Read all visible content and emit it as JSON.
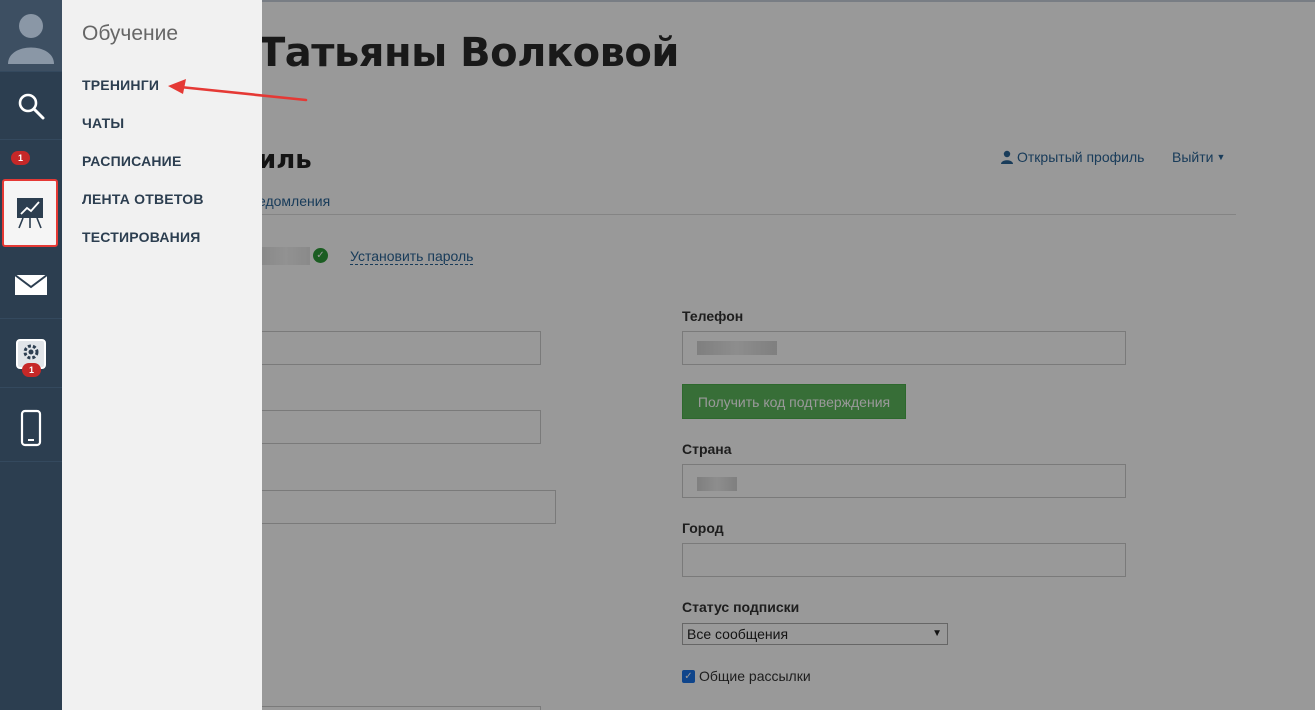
{
  "page": {
    "title": "Татьяны Волковой",
    "section_title": "иль",
    "open_profile": "Открытый профиль",
    "logout": "Выйти",
    "tab_notifications": "едомления",
    "set_password": "Установить пароль"
  },
  "form": {
    "phone_label": "Телефон",
    "get_code_button": "Получить код подтверждения",
    "country_label": "Страна",
    "city_label": "Город",
    "subscription_label": "Статус подписки",
    "subscription_value": "Все сообщения",
    "newsletter_label": "Общие рассылки",
    "newsletter_checked": true
  },
  "sidebar": {
    "badges": {
      "notifications": "1",
      "settings": "1"
    },
    "icons": [
      "user-avatar-icon",
      "search-icon",
      "training-chart-icon",
      "mail-icon",
      "settings-gear-icon",
      "mobile-phone-icon"
    ]
  },
  "menu": {
    "title": "Обучение",
    "items": [
      {
        "label": "ТРЕНИНГИ"
      },
      {
        "label": "ЧАТЫ"
      },
      {
        "label": "РАСПИСАНИЕ"
      },
      {
        "label": "ЛЕНТА ОТВЕТОВ"
      },
      {
        "label": "ТЕСТИРОВАНИЯ"
      }
    ]
  },
  "colors": {
    "rail": "#2c3e50",
    "active_outline": "#e53935",
    "badge": "#c62828",
    "green_button": "#5cb85c",
    "link": "#2a6496",
    "annotation_arrow": "#e53935"
  }
}
